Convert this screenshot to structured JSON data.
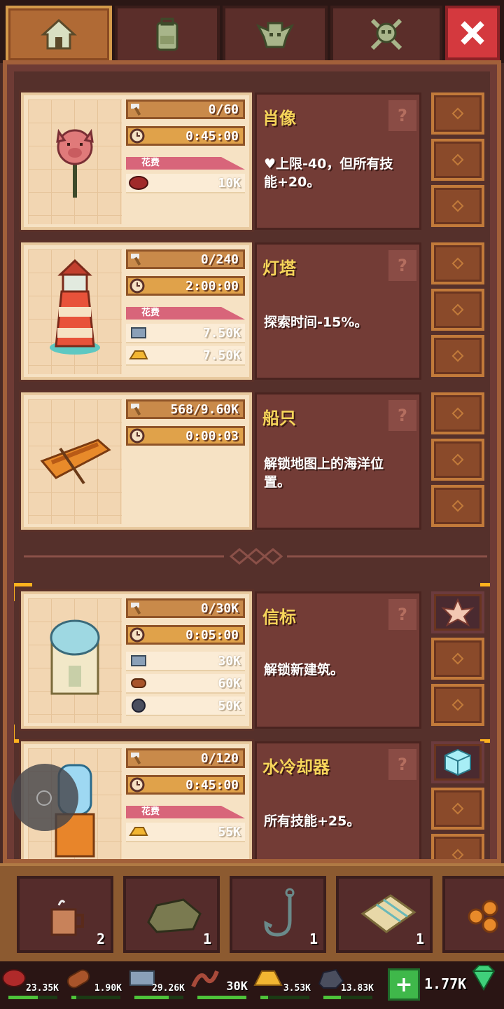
{
  "tabs": [
    {
      "name": "home-icon",
      "active": true
    },
    {
      "name": "backpack-icon",
      "active": false
    },
    {
      "name": "goblin-icon",
      "active": false
    },
    {
      "name": "skull-crossbones-icon",
      "active": false
    }
  ],
  "close_icon": "close-icon",
  "buildings": [
    {
      "art_icon": "pig-portrait-icon",
      "progress": "0/60",
      "time": "0:45:00",
      "cost_label": "花费",
      "costs": [
        {
          "icon": "meat-icon",
          "amount": "10K"
        }
      ],
      "title": "肖像",
      "description": "上限-40，但所有技能+20。",
      "help": "?"
    },
    {
      "art_icon": "lighthouse-icon",
      "progress": "0/240",
      "time": "2:00:00",
      "cost_label": "花费",
      "costs": [
        {
          "icon": "iron-icon",
          "amount": "7.50K"
        },
        {
          "icon": "gold-icon",
          "amount": "7.50K"
        }
      ],
      "title": "灯塔",
      "description": "探索时间-15%。",
      "help": "?"
    },
    {
      "art_icon": "boat-icon",
      "progress": "568/9.60K",
      "time": "0:00:03",
      "cost_label": "",
      "costs": [],
      "title": "船只",
      "description": "解锁地图上的海洋位置。",
      "help": "?"
    },
    {
      "art_icon": "beacon-icon",
      "progress": "0/30K",
      "time": "0:05:00",
      "cost_label": "",
      "costs": [
        {
          "icon": "iron-icon",
          "amount": "30K"
        },
        {
          "icon": "wood-icon",
          "amount": "60K"
        },
        {
          "icon": "coal-icon",
          "amount": "50K"
        }
      ],
      "title": "信标",
      "description": "解锁新建筑。",
      "help": "?"
    },
    {
      "art_icon": "water-cooler-icon",
      "progress": "0/120",
      "time": "0:45:00",
      "cost_label": "花费",
      "costs": [
        {
          "icon": "gold-icon",
          "amount": "55K"
        }
      ],
      "title": "水冷却器",
      "description": "所有技能+25。",
      "help": "?"
    }
  ],
  "inventory": [
    {
      "icon": "coffee-mug-icon",
      "count": "2"
    },
    {
      "icon": "stone-icon",
      "count": "1"
    },
    {
      "icon": "fishing-hook-icon",
      "count": "1"
    },
    {
      "icon": "map-scroll-icon",
      "count": "1"
    },
    {
      "icon": "logs-icon",
      "count": ""
    }
  ],
  "resources": [
    {
      "icon": "meat-icon",
      "amount": "23.35K",
      "fill": 0.6
    },
    {
      "icon": "wood-icon",
      "amount": "1.90K",
      "fill": 0.1
    },
    {
      "icon": "iron-icon",
      "amount": "29.26K",
      "fill": 0.7
    },
    {
      "icon": "rope-icon",
      "amount": "30K",
      "fill": 1.0
    },
    {
      "icon": "gold-icon",
      "amount": "3.53K",
      "fill": 0.15
    },
    {
      "icon": "coal-icon",
      "amount": "13.83K",
      "fill": 0.35
    }
  ],
  "gems": {
    "plus": "+",
    "amount": "1.77K",
    "icon": "emerald-icon"
  },
  "colors": {
    "accent": "#f6d55a",
    "panel": "#6e3b35",
    "bracket": "#ffb21e"
  }
}
